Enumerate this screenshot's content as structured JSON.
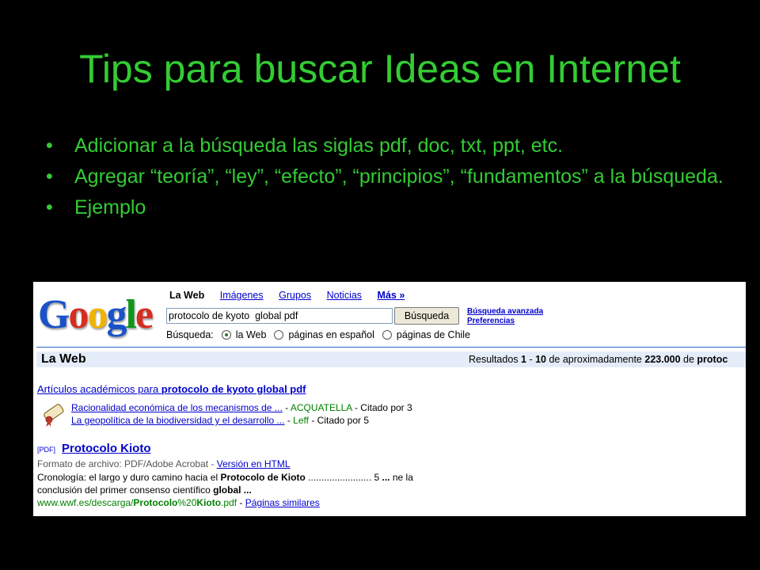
{
  "slide": {
    "title": "Tips para buscar Ideas en Internet",
    "bullet_char": "•",
    "bullets": [
      "Adicionar a la búsqueda las siglas pdf, doc, txt, ppt, etc.",
      "Agregar “teoría”, “ley”, “efecto”, “principios”, “fundamentos” a la búsqueda.",
      "Ejemplo"
    ],
    "accent_color": "#33cc33"
  },
  "google": {
    "logo_letters": [
      "G",
      "o",
      "o",
      "g",
      "l",
      "e"
    ],
    "logo_colors": [
      "#1a52c9",
      "#d62d20",
      "#f0b400",
      "#1a52c9",
      "#109618",
      "#d62d20"
    ],
    "nav": {
      "active": "La Web",
      "links": [
        "Imágenes",
        "Grupos",
        "Noticias"
      ],
      "more": "Más »"
    },
    "search_value": "protocolo de kyoto  global pdf",
    "search_button": "Búsqueda",
    "advanced_link": "Búsqueda avanzada",
    "prefs_link": "Preferencias",
    "scope": {
      "label": "Búsqueda:",
      "options": [
        "la Web",
        "páginas en español",
        "páginas de Chile"
      ],
      "selected": "la Web"
    },
    "results_bar": {
      "title": "La Web",
      "stats_prefix": "Resultados ",
      "from": "1",
      "sep": " - ",
      "to": "10",
      "middle": " de aproximadamente ",
      "total": "223.000",
      "suffix": " de ",
      "query_cut": "protoc"
    },
    "scholar": {
      "header_prefix": "Artículos académicos para ",
      "header_query": "protocolo de kyoto global pdf",
      "items": [
        {
          "title": "Racionalidad económica de los mecanismos de ...",
          "sep": " - ",
          "author": "ACQUATELLA",
          "cited": " - Citado por 3"
        },
        {
          "title": "La geopolítica de la biodiversidad y el desarrollo ...",
          "sep": " - ",
          "author": "Leff",
          "cited": " - Citado por 5"
        }
      ]
    },
    "result": {
      "tag": "[PDF]",
      "title": "Protocolo Kioto",
      "format_prefix": "Formato de archivo: PDF/Adobe Acrobat - ",
      "html_link": "Versión en HTML",
      "snippet1_a": "Cronología: el largo y duro camino hacia el ",
      "snippet1_b": "Protocolo de Kioto",
      "snippet1_c": " ........................ 5 ",
      "snippet1_d": "...",
      "snippet1_e": " ne la",
      "snippet2_a": "conclusión del primer consenso científico ",
      "snippet2_b": "global ...",
      "url_a": "www.wwf.es/descarga/",
      "url_b": "Protocolo",
      "url_c": "%20",
      "url_d": "Kioto",
      "url_e": ".pdf",
      "url_sep": " - ",
      "similar": "Páginas similares"
    }
  }
}
